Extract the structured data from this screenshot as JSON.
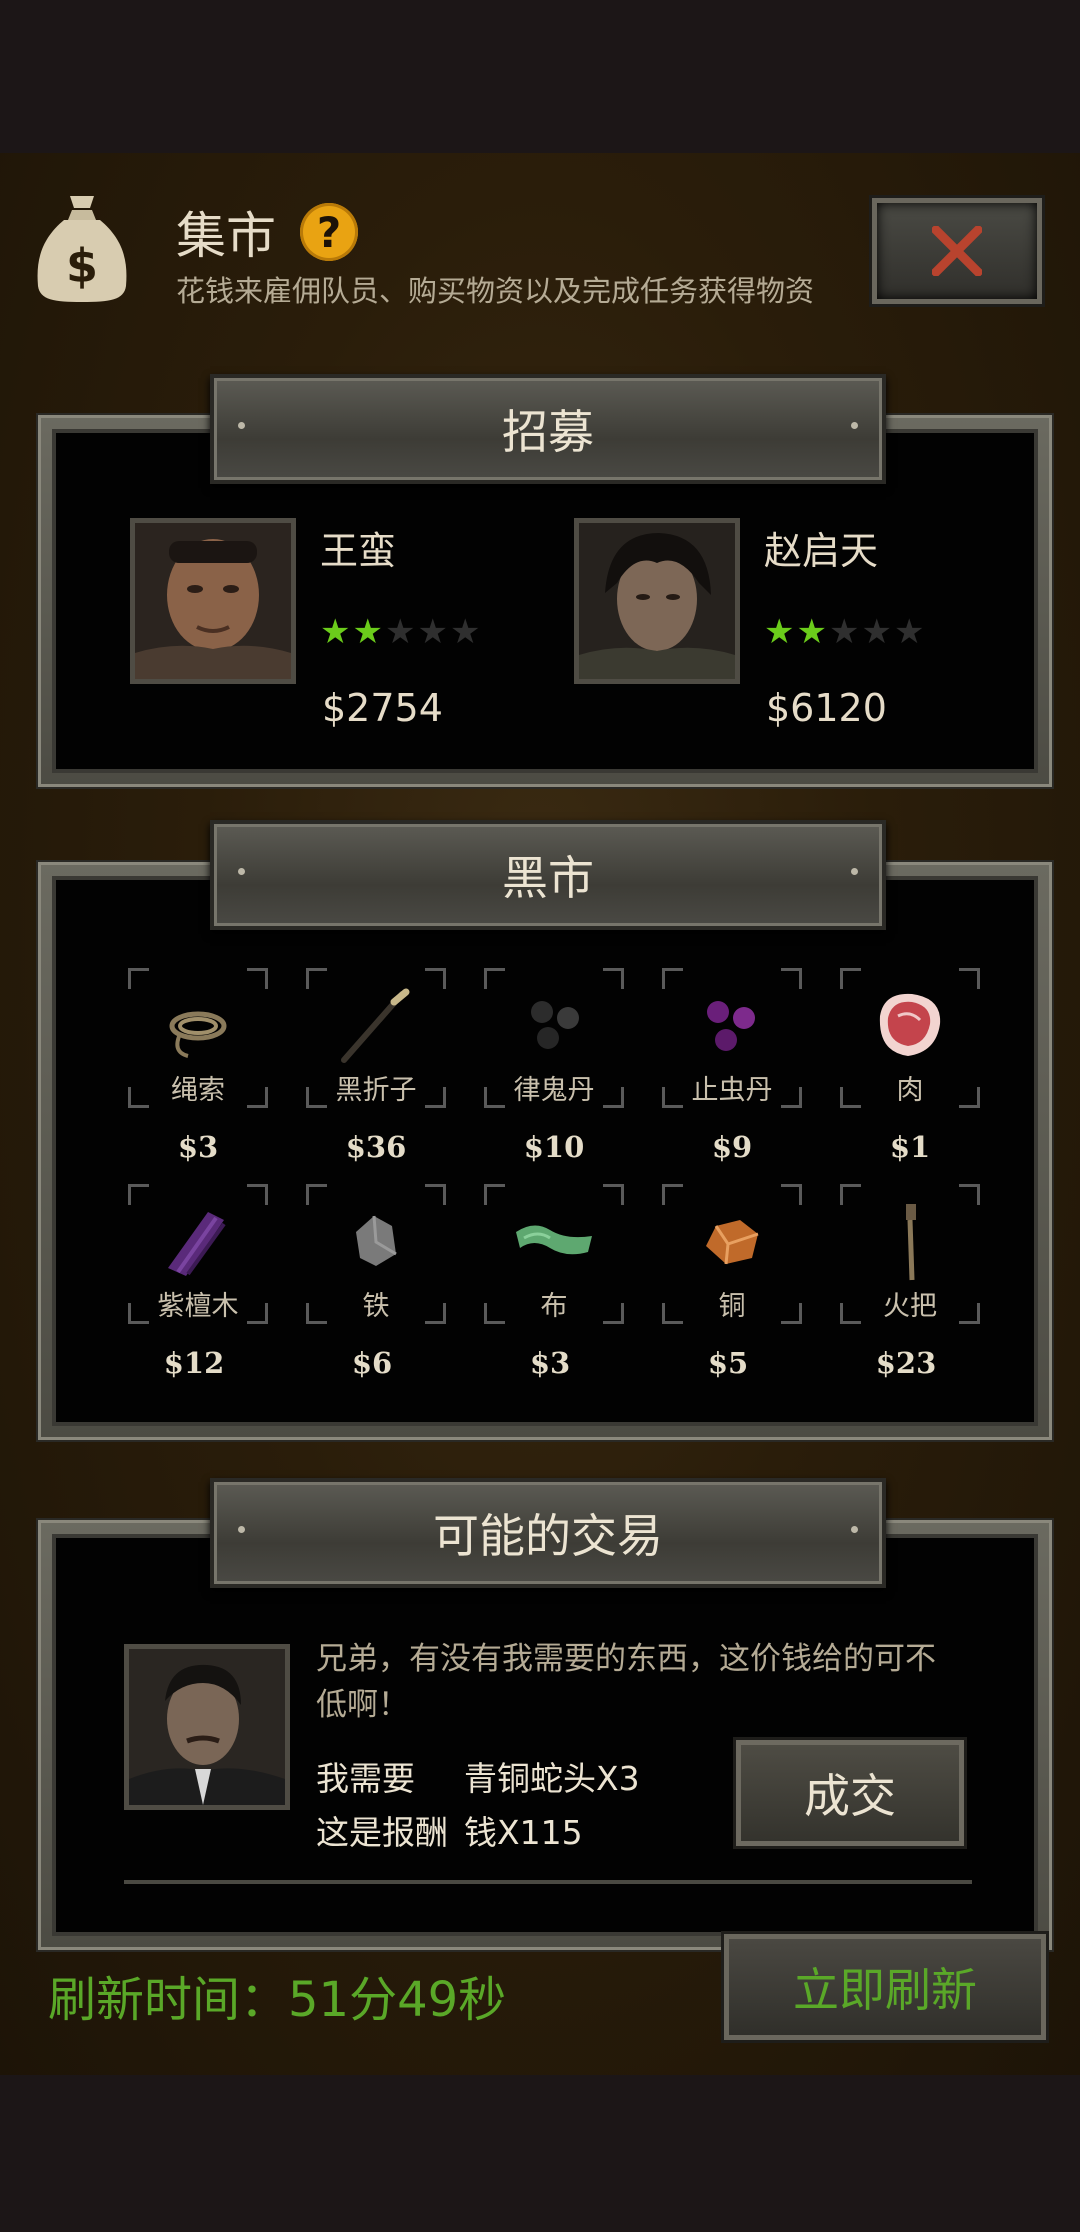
{
  "header": {
    "title": "集市",
    "help": "?",
    "subtitle": "花钱来雇佣队员、购买物资以及完成任务获得物资"
  },
  "recruit": {
    "section_title": "招募",
    "members": [
      {
        "name": "王蛮",
        "stars": 2,
        "max_stars": 5,
        "price": "$2754"
      },
      {
        "name": "赵启天",
        "stars": 2,
        "max_stars": 5,
        "price": "$6120"
      }
    ]
  },
  "black_market": {
    "section_title": "黑市",
    "items": [
      {
        "name": "绳索",
        "price": "$3",
        "icon": "rope-icon"
      },
      {
        "name": "黑折子",
        "price": "$36",
        "icon": "fire-stick-icon"
      },
      {
        "name": "律鬼丹",
        "price": "$10",
        "icon": "black-pills-icon"
      },
      {
        "name": "止虫丹",
        "price": "$9",
        "icon": "purple-pills-icon"
      },
      {
        "name": "肉",
        "price": "$1",
        "icon": "meat-icon"
      },
      {
        "name": "紫檀木",
        "price": "$12",
        "icon": "purple-wood-icon"
      },
      {
        "name": "铁",
        "price": "$6",
        "icon": "iron-ore-icon"
      },
      {
        "name": "布",
        "price": "$3",
        "icon": "cloth-icon"
      },
      {
        "name": "铜",
        "price": "$5",
        "icon": "copper-ore-icon"
      },
      {
        "name": "火把",
        "price": "$23",
        "icon": "torch-icon"
      }
    ]
  },
  "trade": {
    "section_title": "可能的交易",
    "message": "兄弟，有没有我需要的东西，这价钱给的可不低啊！",
    "need_label": "我需要",
    "need_value": "青铜蛇头X3",
    "reward_label": "这是报酬",
    "reward_value": "钱X115",
    "deal_button": "成交"
  },
  "footer": {
    "refresh_time": "刷新时间：51分49秒",
    "refresh_button": "立即刷新"
  },
  "colors": {
    "accent_green": "#5aa828",
    "star_green": "#6bcc1b",
    "help_orange": "#e9a312",
    "close_red": "#c0402a"
  }
}
